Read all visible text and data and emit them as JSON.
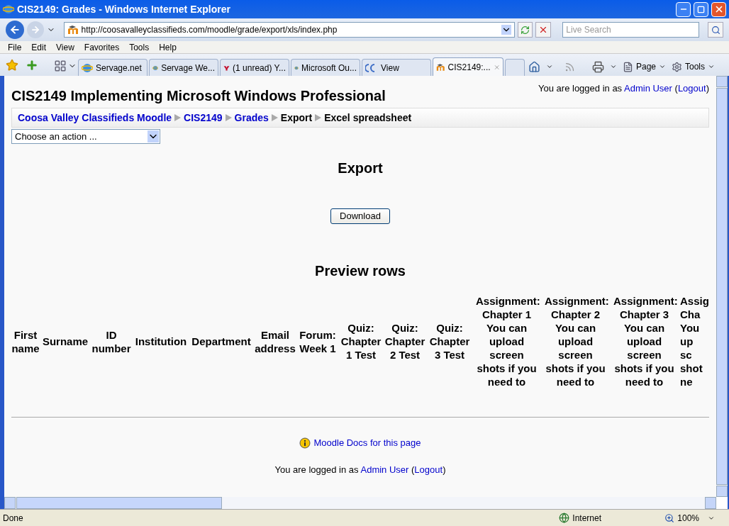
{
  "window": {
    "title": "CIS2149: Grades - Windows Internet Explorer"
  },
  "address_bar": {
    "url": "http://coosavalleyclassifieds.com/moodle/grade/export/xls/index.php",
    "search_placeholder": "Live Search"
  },
  "menu": [
    "File",
    "Edit",
    "View",
    "Favorites",
    "Tools",
    "Help"
  ],
  "tabs": [
    {
      "label": "Servage.net",
      "selected": false,
      "kind": "ie"
    },
    {
      "label": "Servage We...",
      "selected": false,
      "kind": "ie"
    },
    {
      "label": "(1 unread) Y...",
      "selected": false,
      "kind": "yahoo"
    },
    {
      "label": "Microsoft Ou...",
      "selected": false,
      "kind": "ie"
    },
    {
      "label": "View",
      "selected": false,
      "kind": "cvc"
    },
    {
      "label": "CIS2149:...",
      "selected": true,
      "kind": "moodle"
    }
  ],
  "command_bar": [
    {
      "label": "Page",
      "kind": "page"
    },
    {
      "label": "Tools",
      "kind": "gear"
    }
  ],
  "page": {
    "course_title": "CIS2149 Implementing Microsoft Windows Professional",
    "login": {
      "prefix": "You are logged in as",
      "user": "Admin User",
      "open": "(",
      "logout": "Logout",
      "close": ")"
    },
    "breadcrumbs": [
      {
        "label": "Coosa Valley Classifieds Moodle",
        "link": true
      },
      {
        "label": "CIS2149",
        "link": true
      },
      {
        "label": "Grades",
        "link": true
      },
      {
        "label": "Export",
        "link": false
      },
      {
        "label": "Excel spreadsheet",
        "link": false
      }
    ],
    "action_select": "Choose an action ...",
    "export_heading": "Export",
    "download_button": "Download",
    "preview_heading": "Preview rows",
    "columns": [
      "First name",
      "Surname",
      "ID number",
      "Institution",
      "Department",
      "Email address",
      "Forum: Week 1",
      "Quiz: Chapter 1 Test",
      "Quiz: Chapter 2 Test",
      "Quiz: Chapter 3 Test",
      "Assignment: Chapter 1 You can upload screen shots if you need to",
      "Assignment: Chapter 2 You can upload screen shots if you need to",
      "Assignment: Chapter 3 You can upload screen shots if you need to"
    ],
    "cut_column_lines": [
      "Assig",
      "Cha",
      "You",
      "up",
      "sc",
      "shot",
      "ne"
    ],
    "docs_link": "Moodle Docs for this page",
    "footer_login": {
      "prefix": "You are logged in as",
      "user": "Admin User",
      "open": "(",
      "logout": "Logout",
      "close": ")"
    }
  },
  "status_bar": {
    "text": "Done",
    "zone": "Internet",
    "zoom": "100%"
  }
}
